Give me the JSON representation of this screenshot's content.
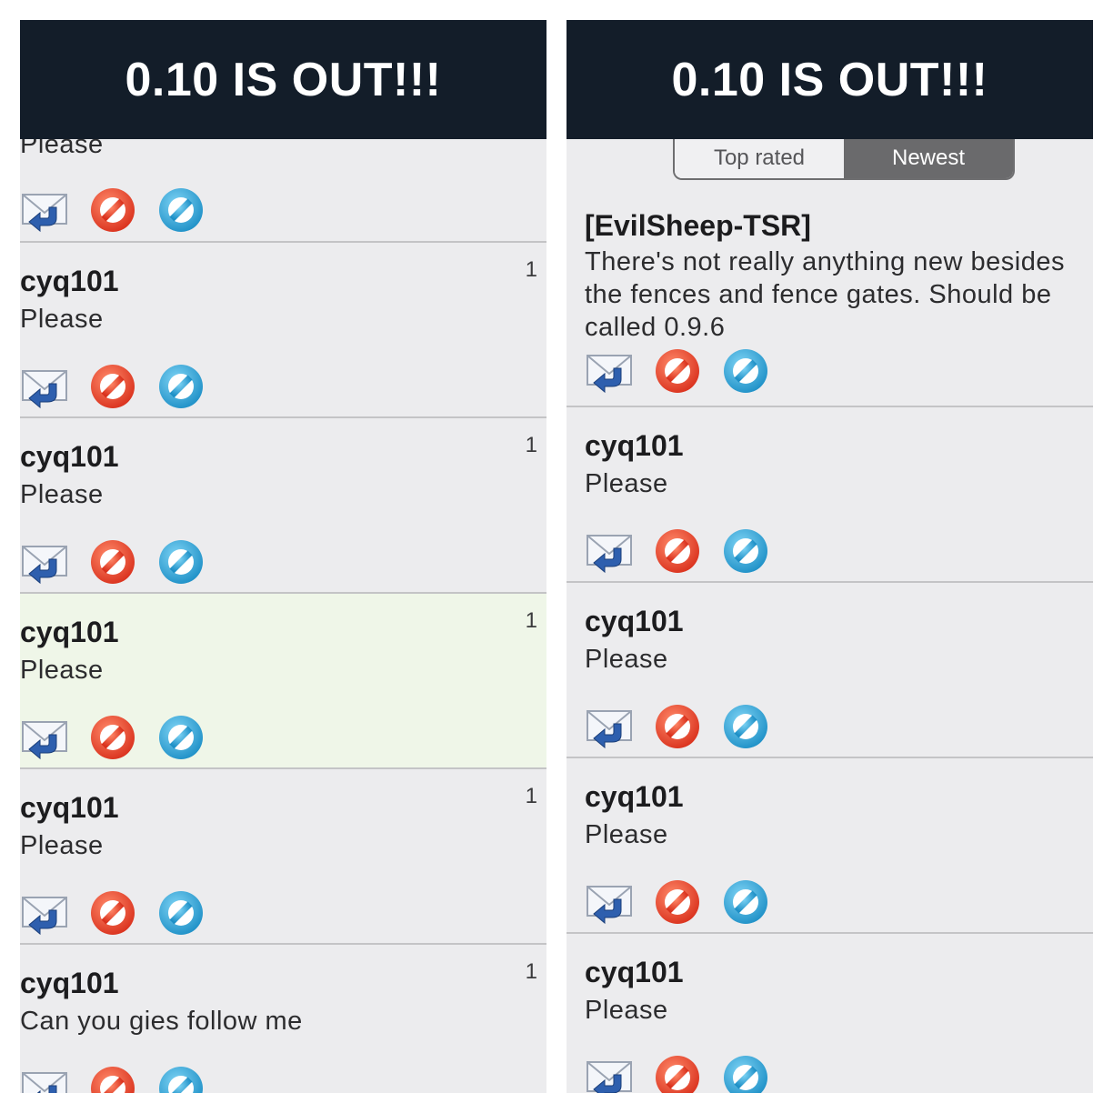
{
  "left_panel": {
    "banner": "0.10 IS OUT!!!",
    "items": [
      {
        "author": "",
        "message": "Please",
        "count": ""
      },
      {
        "author": "cyq101",
        "message": "Please",
        "count": "1"
      },
      {
        "author": "cyq101",
        "message": "Please",
        "count": "1"
      },
      {
        "author": "cyq101",
        "message": "Please",
        "count": "1"
      },
      {
        "author": "cyq101",
        "message": "Please",
        "count": "1"
      },
      {
        "author": "cyq101",
        "message": "Can you gies follow me",
        "count": "1"
      }
    ]
  },
  "right_panel": {
    "banner": "0.10 IS OUT!!!",
    "tabs": [
      "Top rated",
      "Newest"
    ],
    "selected_tab": "Newest",
    "items": [
      {
        "author": "[EvilSheep-TSR]",
        "message": "There's not really anything new besides the fences and fence gates. Should be called 0.9.6"
      },
      {
        "author": "cyq101",
        "message": "Please"
      },
      {
        "author": "cyq101",
        "message": "Please"
      },
      {
        "author": "cyq101",
        "message": "Please"
      },
      {
        "author": "cyq101",
        "message": "Please"
      }
    ]
  },
  "icons": [
    "reply-mail-icon",
    "block-red-icon",
    "block-blue-icon"
  ],
  "colors": {
    "banner": "#131d29",
    "highlight": "#eff6e8",
    "red": "#e8412e",
    "blue": "#2aa3d8"
  }
}
